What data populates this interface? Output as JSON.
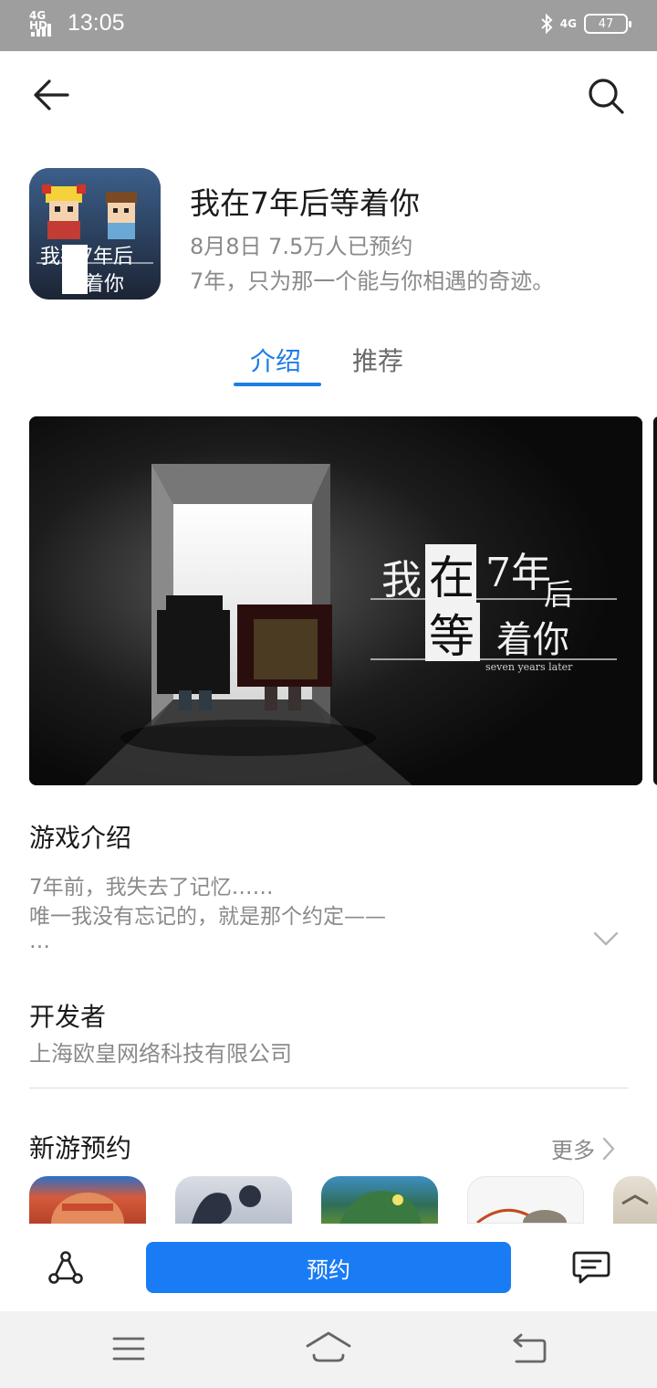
{
  "status_bar": {
    "network": "4G HD",
    "time": "13:05",
    "signal_right": "4G",
    "battery": "47"
  },
  "app": {
    "title": "我在7年后等着你",
    "meta": "8月8日 7.5万人已预约",
    "slogan": "7年，只为那一个能与你相遇的奇迹。",
    "icon_text": {
      "line1": "我在7年后",
      "line2": "等着你"
    }
  },
  "tabs": [
    {
      "label": "介绍",
      "active": true
    },
    {
      "label": "推荐",
      "active": false
    }
  ],
  "banner": {
    "title_line1_a": "我",
    "title_line1_b": "在",
    "title_line1_c": "7年",
    "title_line1_d": "后",
    "title_line2_a": "等",
    "title_line2_b": "着你",
    "subtitle": "seven years later"
  },
  "intro": {
    "heading": "游戏介绍",
    "lines": [
      "7年前，我失去了记忆……",
      "唯一我没有忘记的，就是那个约定——",
      "…"
    ]
  },
  "developer": {
    "heading": "开发者",
    "name": "上海欧皇网络科技有限公司"
  },
  "new_games": {
    "heading": "新游预约",
    "more": "更多"
  },
  "action_bar": {
    "reserve": "预约"
  },
  "colors": {
    "accent": "#1e7ce6",
    "button": "#1a7cf5",
    "status_bar": "#9e9e9e",
    "secondary_text": "#8a8a8a"
  },
  "icons": [
    "back-arrow-icon",
    "search-icon",
    "chevron-down-icon",
    "chevron-right-icon",
    "share-icon",
    "comment-icon",
    "menu-icon",
    "home-icon",
    "return-icon",
    "bluetooth-icon",
    "signal-icon",
    "battery-icon"
  ]
}
